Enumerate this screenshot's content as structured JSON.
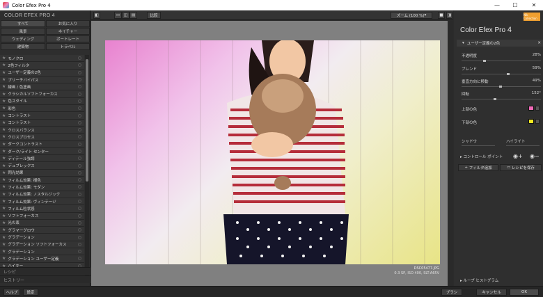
{
  "window": {
    "title": "Color Efex Pro 4",
    "minimize": "—",
    "maximize": "☐",
    "close": "✕"
  },
  "left_panel": {
    "brand": "COLOR EFEX PRO 4",
    "categories": [
      "すべて",
      "お気に入り",
      "風景",
      "ネイチャー",
      "ウェディング",
      "ポートレート",
      "建築物",
      "トラベル"
    ],
    "filters": [
      "モノクロ",
      "2色フィルタ",
      "ユーザー定義の2色",
      "ブリーチバイパス",
      "線画 / 色塗画",
      "クラシカルソフトフォーカス",
      "色スタイル",
      "彩色",
      "コントラスト",
      "コントラスト",
      "クロスバランス",
      "クロスプロセス",
      "ダークコントラスト",
      "ダーク/ライト センター",
      "ディテール強調",
      "デュプレックス",
      "閃光効果",
      "フィルム効果: 褪色",
      "フィルム効果: モダン",
      "フィルム効果: ノスタルジック",
      "フィルム効果: ヴィンテージ",
      "フィルム粒状感",
      "ソフトフォーカス",
      "光の束",
      "グラマーグロウ",
      "グラデーション",
      "グラデーション ソフトフォーカス",
      "グラデーション",
      "グラデーション ユーザー定義",
      "ハイキー"
    ],
    "recipes": "レシピ",
    "history": "ヒストリー"
  },
  "toolbar": {
    "compare": "比較",
    "zoom": "ズーム (100 %)"
  },
  "image": {
    "filename": "DSC05477.JPG",
    "info": "0.3 SP, ISO 400, SLT-A65V"
  },
  "right_panel": {
    "logo": "Nik Collection",
    "title": "Color Efex Pro",
    "version": "4",
    "section": "ユーザー定義の2色",
    "params": [
      {
        "label": "不透明度",
        "value": "28%",
        "pos": 0.28
      },
      {
        "label": "ブレンド",
        "value": "59%",
        "pos": 0.59
      },
      {
        "label": "垂直方向に移動",
        "value": "49%",
        "pos": 0.49
      },
      {
        "label": "回転",
        "value": "152°",
        "pos": 0.42
      }
    ],
    "upper_color_label": "上部の色",
    "lower_color_label": "下部の色",
    "upper_color": "#f06ab8",
    "lower_color": "#f2e820",
    "shadow_label": "シャドウ",
    "highlight_label": "ハイライト",
    "control_points": "コントロール ポイント",
    "add_filter": "フィルタ追加",
    "save_recipe": "レシピを保存",
    "histogram": "ループ ヒストグラム"
  },
  "bottom": {
    "help": "ヘルプ",
    "settings": "設定",
    "brush": "ブラシ",
    "cancel": "キャンセル",
    "ok": "OK"
  }
}
